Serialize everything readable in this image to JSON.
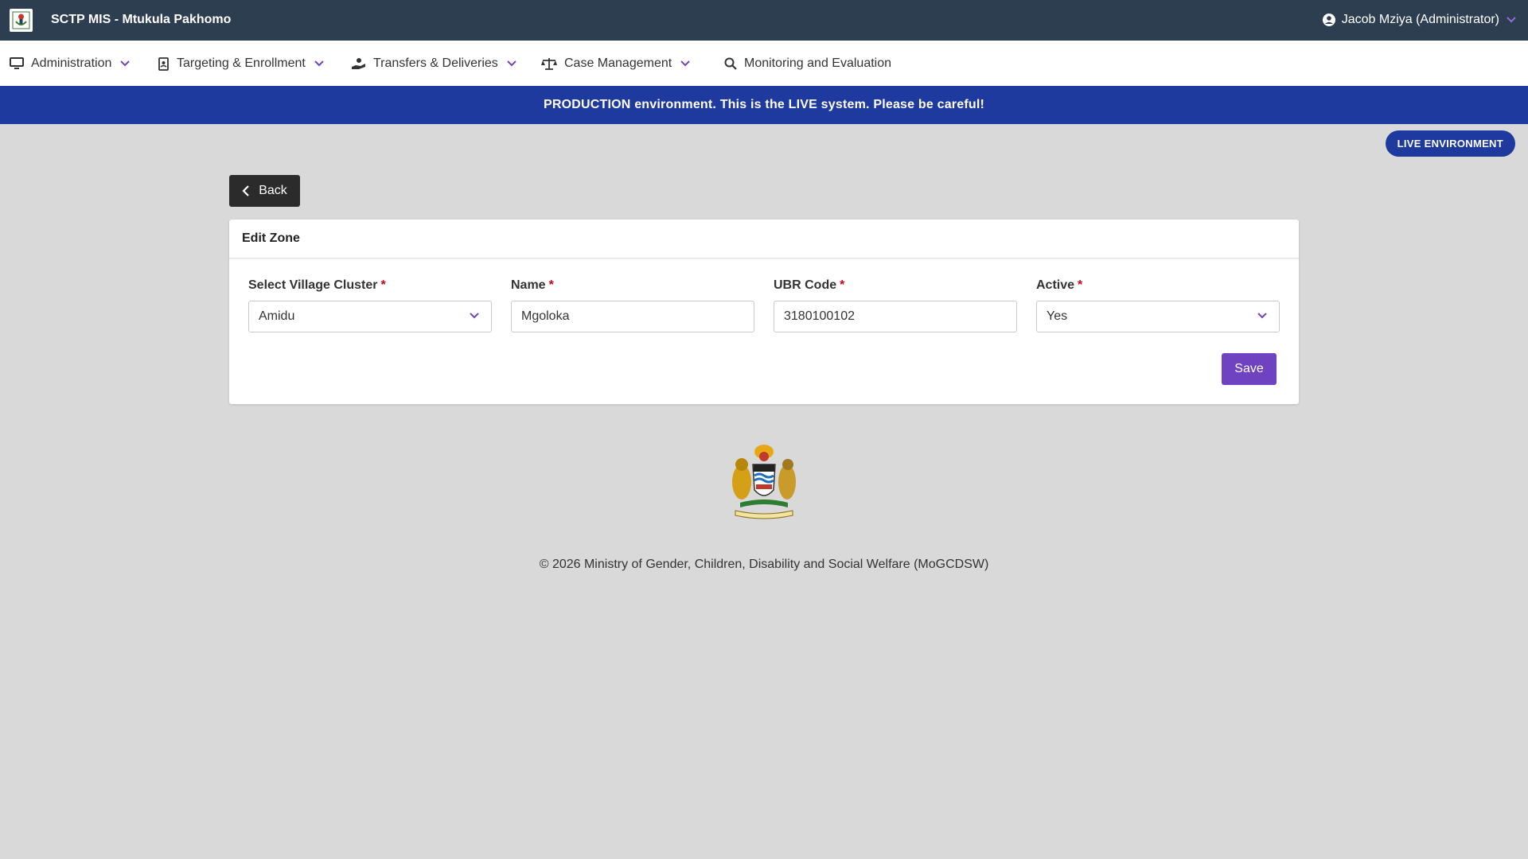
{
  "app": {
    "title": "SCTP MIS - Mtukula Pakhomo",
    "user": "Jacob Mziya (Administrator)"
  },
  "nav": {
    "items": [
      {
        "label": "Administration",
        "icon": "monitor-icon",
        "has_dropdown": true
      },
      {
        "label": "Targeting & Enrollment",
        "icon": "address-book-icon",
        "has_dropdown": true
      },
      {
        "label": "Transfers & Deliveries",
        "icon": "hand-holding-icon",
        "has_dropdown": true
      },
      {
        "label": "Case Management",
        "icon": "scale-icon",
        "has_dropdown": true
      },
      {
        "label": "Monitoring and Evaluation",
        "icon": "search-icon",
        "has_dropdown": false
      }
    ]
  },
  "banner": {
    "text": "PRODUCTION environment. This is the LIVE system. Please be careful!",
    "badge": "LIVE ENVIRONMENT"
  },
  "page": {
    "back_label": "Back",
    "card_title": "Edit Zone",
    "fields": [
      {
        "label": "Select Village Cluster",
        "required": "*",
        "value": "Amidu",
        "type": "select"
      },
      {
        "label": "Name",
        "required": "*",
        "value": "Mgoloka",
        "type": "text"
      },
      {
        "label": "UBR Code",
        "required": "*",
        "value": "3180100102",
        "type": "text"
      },
      {
        "label": "Active",
        "required": "*",
        "value": "Yes",
        "type": "select"
      }
    ],
    "save_label": "Save"
  },
  "footer": {
    "text": "© 2026 Ministry of Gender, Children, Disability and Social Welfare (MoGCDSW)"
  },
  "colors": {
    "topbar": "#2d3e50",
    "banner": "#1f3a9e",
    "accent": "#6f42c1",
    "required": "#d0021b"
  }
}
